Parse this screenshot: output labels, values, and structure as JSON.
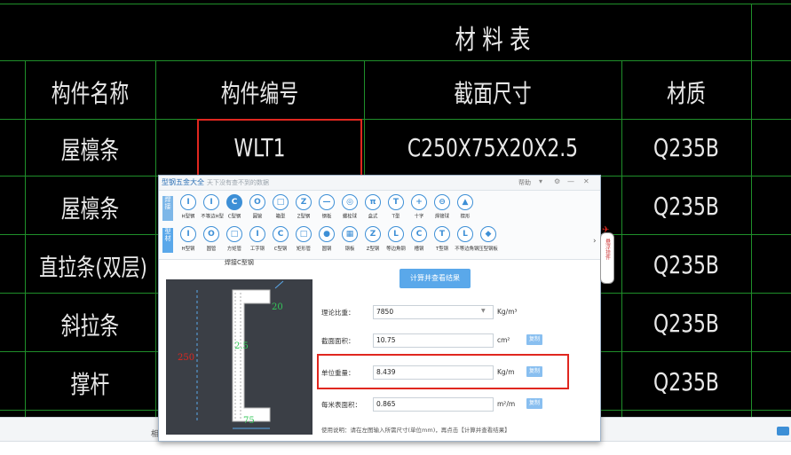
{
  "cad": {
    "title": "材 料 表",
    "headers": [
      "构件名称",
      "构件编号",
      "截面尺寸",
      "材质"
    ],
    "rows": [
      {
        "name": "屋檩条",
        "code": "WLT1",
        "section": "C250X75X20X2.5",
        "material": "Q235B"
      },
      {
        "name": "屋檩条",
        "material": "Q235B"
      },
      {
        "name": "直拉条(双层)",
        "material": "Q235B"
      },
      {
        "name": "斜拉条",
        "material": "Q235B"
      },
      {
        "name": "撑杆",
        "material": "Q235B"
      }
    ],
    "line_color": "#1f8f2a",
    "highlight_color": "#e0271f"
  },
  "statusbar": {
    "label": "相"
  },
  "dialog": {
    "title": "型钢五金大全",
    "subtitle": "天下没有查不到的数据",
    "help": "帮助",
    "side_tab1": "焊接",
    "side_tab2": "型材",
    "row1": [
      {
        "icon": "I",
        "label": "H型钢"
      },
      {
        "icon": "I",
        "label": "不等边H型"
      },
      {
        "icon": "C",
        "label": "C型钢"
      },
      {
        "icon": "O",
        "label": "圆管"
      },
      {
        "icon": "□",
        "label": "箱型"
      },
      {
        "icon": "Z",
        "label": "Z型钢"
      },
      {
        "icon": "—",
        "label": "钢板"
      },
      {
        "icon": "◎",
        "label": "螺栓球"
      },
      {
        "icon": "π",
        "label": "盒式"
      },
      {
        "icon": "T",
        "label": "T型"
      },
      {
        "icon": "+",
        "label": "十字"
      },
      {
        "icon": "⊖",
        "label": "焊接球"
      },
      {
        "icon": "▲",
        "label": "楔形"
      }
    ],
    "row2": [
      {
        "icon": "I",
        "label": "H型钢"
      },
      {
        "icon": "O",
        "label": "圆管"
      },
      {
        "icon": "□",
        "label": "方矩管"
      },
      {
        "icon": "I",
        "label": "工字钢"
      },
      {
        "icon": "C",
        "label": "C型钢"
      },
      {
        "icon": "□",
        "label": "矩形管"
      },
      {
        "icon": "●",
        "label": "圆钢"
      },
      {
        "icon": "▦",
        "label": "钢板"
      },
      {
        "icon": "Z",
        "label": "Z型钢"
      },
      {
        "icon": "L",
        "label": "等边角钢"
      },
      {
        "icon": "C",
        "label": "槽钢"
      },
      {
        "icon": "T",
        "label": "T型钢"
      },
      {
        "icon": "L",
        "label": "不等边角钢"
      },
      {
        "icon": "◆",
        "label": "压型钢板"
      }
    ],
    "panel_title": "焊接C型钢",
    "dims": {
      "h": "250",
      "b": "75",
      "c": "20",
      "t": "2.5"
    },
    "calc_button": "计算并查看结果",
    "fields": {
      "theory_label": "理论比重：",
      "theory_value": "7850",
      "theory_unit": "Kg/m³",
      "area_label": "截面面积：",
      "area_value": "10.75",
      "area_unit": "cm²",
      "weight_label": "单位重量：",
      "weight_value": "8.439",
      "weight_unit": "Kg/m",
      "surface_label": "每米表面积：",
      "surface_value": "0.865",
      "surface_unit": "m²/m",
      "copy": "复制"
    },
    "hint": "使用说明：请在左图输入所需尺寸(单位mm)，再点击【计算并查看结果】",
    "accent": "#3d8fd6"
  },
  "widget": {
    "text": "悬浮挂件"
  }
}
